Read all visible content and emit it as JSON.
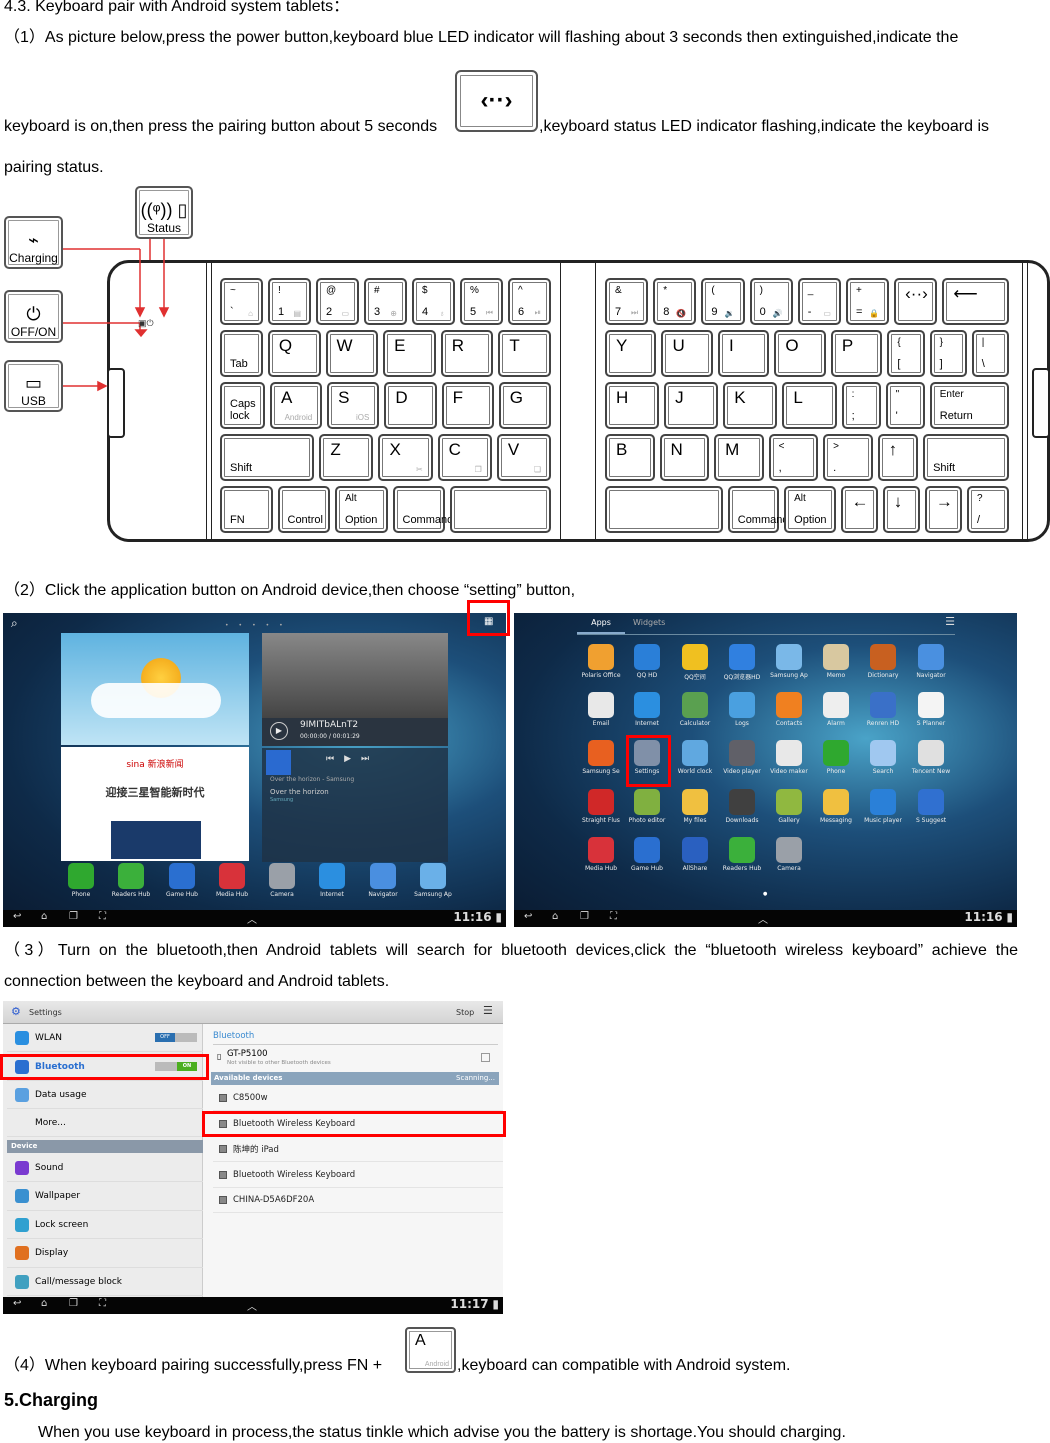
{
  "heading": "4.3. Keyboard pair with Android system tablets：",
  "step1": {
    "line1": "（1）As picture below,press the power button,keyboard blue LED indicator will flashing about 3 seconds then extinguished,indicate the",
    "line2a": "keyboard is on,then press the pairing button about 5 seconds",
    "pair_key_glyph": "‹··›",
    "line2b": ",keyboard status LED indicator flashing,indicate the keyboard is",
    "line3": "pairing status."
  },
  "keyboard_diagram": {
    "labels": {
      "status": "Status",
      "charging": "Charging",
      "power": "OFF/ON",
      "usb": "USB"
    },
    "leader_color": "#e03030",
    "left_rows": [
      [
        {
          "t": "~",
          "b": "`",
          "s": "⌂"
        },
        {
          "t": "!",
          "b": "1",
          "s": "▤"
        },
        {
          "t": "@",
          "b": "2",
          "s": "▭"
        },
        {
          "t": "#",
          "b": "3",
          "s": "⊕"
        },
        {
          "t": "$",
          "b": "4",
          "s": "♁"
        },
        {
          "t": "%",
          "b": "5",
          "s": "⏮"
        },
        {
          "t": "^",
          "b": "6",
          "s": "⏯"
        }
      ],
      [
        {
          "b": "Tab",
          "w": 0.8
        },
        {
          "big": "Q"
        },
        {
          "big": "W"
        },
        {
          "big": "E"
        },
        {
          "big": "R"
        },
        {
          "big": "T"
        }
      ],
      [
        {
          "b": "Caps lock",
          "w": 0.85
        },
        {
          "big": "A",
          "s": "Android"
        },
        {
          "big": "S",
          "s": "iOS"
        },
        {
          "big": "D"
        },
        {
          "big": "F"
        },
        {
          "big": "G"
        }
      ],
      [
        {
          "b": "Shift",
          "w": 1.8
        },
        {
          "big": "Z"
        },
        {
          "big": "X",
          "s": "✂"
        },
        {
          "big": "C",
          "s": "❐"
        },
        {
          "big": "V",
          "s": "❏"
        }
      ],
      [
        {
          "b": "FN"
        },
        {
          "b": "Control"
        },
        {
          "t": "Alt",
          "b": "Option"
        },
        {
          "b": "Command"
        },
        {
          "b": "",
          "w": 2
        }
      ]
    ],
    "right_rows": [
      [
        {
          "t": "&",
          "b": "7",
          "s": "⏭"
        },
        {
          "t": "*",
          "b": "8",
          "s": "🔇"
        },
        {
          "t": "(",
          "b": "9",
          "s": "🔉"
        },
        {
          "t": ")",
          "b": "0",
          "s": "🔊"
        },
        {
          "t": "_",
          "b": "-",
          "s": "▭"
        },
        {
          "t": "+",
          "b": "=",
          "s": "🔒"
        },
        {
          "big": "‹··›"
        },
        {
          "big": "⟵",
          "w": 1.6
        }
      ],
      [
        {
          "big": "Y"
        },
        {
          "big": "U"
        },
        {
          "big": "I"
        },
        {
          "big": "O"
        },
        {
          "big": "P"
        },
        {
          "t": "{",
          "b": "[",
          "w": 0.7
        },
        {
          "t": "}",
          "b": "]",
          "w": 0.7
        },
        {
          "t": "|",
          "b": "\\",
          "w": 0.7
        }
      ],
      [
        {
          "big": "H"
        },
        {
          "big": "J"
        },
        {
          "big": "K"
        },
        {
          "big": "L"
        },
        {
          "t": ":",
          "b": ";",
          "w": 0.7
        },
        {
          "t": "\"",
          "b": "'",
          "w": 0.7
        },
        {
          "t": "Enter",
          "b": "Return",
          "w": 1.5
        }
      ],
      [
        {
          "big": "B"
        },
        {
          "big": "N"
        },
        {
          "big": "M"
        },
        {
          "t": "<",
          "b": ","
        },
        {
          "t": ">",
          "b": "."
        },
        {
          "big": "↑",
          "w": 0.8
        },
        {
          "b": "Shift",
          "w": 1.8
        }
      ],
      [
        {
          "b": "",
          "w": 2.4
        },
        {
          "b": "Command"
        },
        {
          "t": "Alt",
          "b": "Option"
        },
        {
          "big": "←",
          "w": 0.7
        },
        {
          "big": "↓",
          "w": 0.7
        },
        {
          "big": "→",
          "w": 0.7
        },
        {
          "t": "?",
          "b": "/",
          "w": 0.8
        }
      ]
    ]
  },
  "step2": {
    "text": "（2）Click the application button on Android device,then choose “setting” button,",
    "home_screen": {
      "video_title": "9IMITbALnT2",
      "video_time": "00:00:00 / 00:01:29",
      "music_line": "Over the horizon - Samsung",
      "track_title": "Over the horizon",
      "track_artist": "Samsung",
      "news_brand": "sina 新浪新闻",
      "news_headline": "迎接三星智能新时代",
      "dock": [
        {
          "label": "Phone",
          "color": "#2fa82f"
        },
        {
          "label": "Readers Hub",
          "color": "#3bb03b"
        },
        {
          "label": "Game Hub",
          "color": "#2a6fd0"
        },
        {
          "label": "Media Hub",
          "color": "#d8323a"
        },
        {
          "label": "Camera",
          "color": "#9aa0a8"
        },
        {
          "label": "Internet",
          "color": "#2b8fe0"
        },
        {
          "label": "Navigator",
          "color": "#4a8fe0"
        },
        {
          "label": "Samsung Ap",
          "color": "#6ab0e8"
        }
      ],
      "clock": "11:16"
    },
    "apps_screen": {
      "tabs": [
        "Apps",
        "Widgets"
      ],
      "apps": [
        {
          "label": "Polaris Office",
          "color": "#f0a030"
        },
        {
          "label": "QQ HD",
          "color": "#2a7fd8"
        },
        {
          "label": "QQ空间",
          "color": "#f0c020"
        },
        {
          "label": "QQ浏览器HD",
          "color": "#3080e0"
        },
        {
          "label": "Samsung Ap",
          "color": "#7ab8e8"
        },
        {
          "label": "Memo",
          "color": "#d8c8a0"
        },
        {
          "label": "Dictionary",
          "color": "#c86020"
        },
        {
          "label": "Navigator",
          "color": "#4a90e0"
        },
        {
          "label": "Email",
          "color": "#e8e8e8"
        },
        {
          "label": "Internet",
          "color": "#2b8fe0"
        },
        {
          "label": "Calculator",
          "color": "#5aa050"
        },
        {
          "label": "Logs",
          "color": "#4aa0e0"
        },
        {
          "label": "Contacts",
          "color": "#f08020"
        },
        {
          "label": "Alarm",
          "color": "#eeeeee"
        },
        {
          "label": "Renren HD",
          "color": "#3a70c8"
        },
        {
          "label": "S Planner",
          "color": "#f4f4f4"
        },
        {
          "label": "Samsung Se",
          "color": "#e86020"
        },
        {
          "label": "Settings",
          "color": "#8090a8"
        },
        {
          "label": "World clock",
          "color": "#60a8e0"
        },
        {
          "label": "Video player",
          "color": "#606068"
        },
        {
          "label": "Video maker",
          "color": "#e8e8e8"
        },
        {
          "label": "Phone",
          "color": "#2fa82f"
        },
        {
          "label": "Search",
          "color": "#a0c8f0"
        },
        {
          "label": "Tencent New",
          "color": "#e0e0e0"
        },
        {
          "label": "Straight Flus",
          "color": "#d02828"
        },
        {
          "label": "Photo editor",
          "color": "#80b040"
        },
        {
          "label": "My files",
          "color": "#f0c040"
        },
        {
          "label": "Downloads",
          "color": "#404040"
        },
        {
          "label": "Gallery",
          "color": "#90b840"
        },
        {
          "label": "Messaging",
          "color": "#f0c040"
        },
        {
          "label": "Music player",
          "color": "#2a80d8"
        },
        {
          "label": "S Suggest",
          "color": "#3070d0"
        },
        {
          "label": "Media Hub",
          "color": "#d8323a"
        },
        {
          "label": "Game Hub",
          "color": "#2a6fd0"
        },
        {
          "label": "AllShare",
          "color": "#2a60c0"
        },
        {
          "label": "Readers Hub",
          "color": "#3bb03b"
        },
        {
          "label": "Camera",
          "color": "#9aa0a8"
        }
      ],
      "clock": "11:16"
    }
  },
  "step3": {
    "line1": "（3）Turn on the bluetooth,then Android tablets will search for bluetooth devices,click the “bluetooth wireless keyboard” achieve the",
    "line2": "connection between the keyboard and Android tablets.",
    "settings_screen": {
      "title": "Settings",
      "stop": "Stop",
      "left_items": [
        {
          "label": "WLAN",
          "color": "#2a8fe0",
          "toggle": "OFF"
        },
        {
          "label": "Bluetooth",
          "color": "#2a6fd0",
          "toggle": "ON"
        },
        {
          "label": "Data usage",
          "color": "#5aa0e0"
        },
        {
          "label": "More..."
        }
      ],
      "section_device": "Device",
      "device_items": [
        {
          "label": "Sound",
          "color": "#7a3ad0"
        },
        {
          "label": "Wallpaper",
          "color": "#3a90d0"
        },
        {
          "label": "Lock screen",
          "color": "#30a0d0"
        },
        {
          "label": "Display",
          "color": "#e07020"
        },
        {
          "label": "Call/message block",
          "color": "#40a0c0"
        }
      ],
      "bt_header": "Bluetooth",
      "own_device": "GT-P5100",
      "own_device_sub": "Not visible to other Bluetooth devices",
      "available": "Available devices",
      "scanning": "Scanning...",
      "devices": [
        "C8500w",
        "Bluetooth Wireless Keyboard",
        "陈坤的 iPad",
        "Bluetooth Wireless Keyboard",
        "CHINA-D5A6DF20A"
      ],
      "clock": "11:17"
    }
  },
  "step4": {
    "text_a": "（4）When keyboard pairing successfully,press FN + ",
    "key_letter": "A",
    "key_sub": "Android",
    "text_b": ",keyboard can compatible with Android system."
  },
  "charging": {
    "heading": "5.Charging",
    "text": "When you use keyboard in process,the status tinkle which advise you the battery is shortage.You should charging."
  },
  "highlight_color": "#ff0000"
}
